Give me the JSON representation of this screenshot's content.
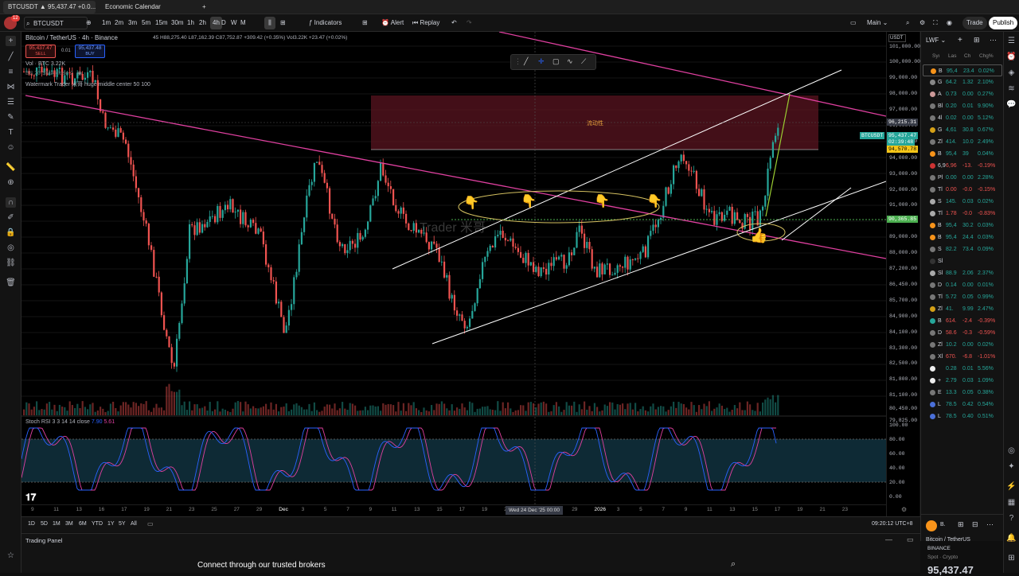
{
  "tabs": [
    {
      "label": "BTCUSDT ▲ 95,437.47 +0.0..."
    },
    {
      "label": "Economic Calendar"
    }
  ],
  "tab_add": "+",
  "toolbar": {
    "symbol": "BTCUSDT",
    "intervals": [
      "1m",
      "2m",
      "3m",
      "5m",
      "15m",
      "30m",
      "1h",
      "2h",
      "4h",
      "D",
      "W",
      "M"
    ],
    "active_interval": "4h",
    "indicators": "Indicators",
    "alert": "Alert",
    "replay": "Replay",
    "layout": "Main",
    "trade": "Trade",
    "publish": "Publish",
    "notif_count": "12"
  },
  "legend": {
    "title": "Bitcoin / TetherUS · 4h · Binance",
    "ohlc": "45  H88,275.40  L87,162.39  C87,752.87  +309.42 (+0.35%)  Vol3.22K  +23.47 (+0.02%)",
    "sell_price": "95,437.47",
    "sell_label": "SELL",
    "spread": "0.01",
    "buy_price": "95,437.48",
    "buy_label": "BUY",
    "vol": "Vol · BTC  3.22K",
    "bb": "BB 20 SMA close 2",
    "watermark_ind": "Watermark Trader 米哥 huge middle center 50 100",
    "watermark": "Trader 米哥",
    "zone_label": "流动性"
  },
  "stoch": {
    "title": "Stoch RSI 3 3 14 14 close",
    "k": "7.90",
    "d": "5.61"
  },
  "price_axis": {
    "currency": "USDT",
    "ticks": [
      "101,000.00",
      "100,000.00",
      "99,000.00",
      "98,000.00",
      "97,000.00",
      "96,000.00",
      "95,000.00",
      "94,000.00",
      "93,000.00",
      "92,000.00",
      "91,000.00",
      "90,000.00",
      "89,000.00",
      "88,000.00",
      "87,200.00",
      "86,450.00",
      "85,700.00",
      "84,900.00",
      "84,100.00",
      "83,300.00",
      "82,500.00",
      "81,800.00",
      "81,100.00",
      "80,450.00",
      "79,825.00"
    ],
    "crosshair": "96,215.31",
    "last_symbol": "BTCUSDT",
    "last_price": "95,437.47",
    "countdown": "02:39:48",
    "level1": "94,570.78",
    "level2": "90,365.85",
    "osc_ticks": [
      "100.00",
      "80.00",
      "60.00",
      "40.00",
      "20.00",
      "0.00"
    ]
  },
  "time_axis": [
    "9",
    "11",
    "13",
    "16",
    "17",
    "19",
    "21",
    "23",
    "25",
    "27",
    "29",
    "Dec",
    "3",
    "5",
    "7",
    "9",
    "11",
    "13",
    "15",
    "17",
    "19",
    "21",
    "",
    "27",
    "29",
    "2026",
    "3",
    "5",
    "7",
    "9",
    "11",
    "13",
    "15",
    "17",
    "19",
    "21",
    "23"
  ],
  "crosshair_time": "Wed 24 Dec '25   00:00",
  "ranges": [
    "1D",
    "5D",
    "1M",
    "3M",
    "6M",
    "YTD",
    "1Y",
    "5Y",
    "All"
  ],
  "clock": "09:20:12 UTC+8",
  "trading_panel": "Trading Panel",
  "brokers": "Connect through our trusted brokers",
  "watchlist": {
    "name": "LWF",
    "headers": [
      "Syı",
      "Las",
      "Ch",
      "Chg%"
    ],
    "rows": [
      {
        "sym": "B",
        "last": "95,4",
        "ch": "23.4",
        "pct": "0.02%",
        "color": "#26a69a",
        "dot": "#f7931a"
      },
      {
        "sym": "G",
        "last": "64.2",
        "ch": "1.32",
        "pct": "2.10%",
        "color": "#26a69a",
        "dot": "#888"
      },
      {
        "sym": "A",
        "last": "0.73",
        "ch": "0.00",
        "pct": "0.27%",
        "color": "#26a69a",
        "dot": "#c99"
      },
      {
        "sym": "Bl",
        "last": "0.20",
        "ch": "0.01",
        "pct": "9.90%",
        "color": "#26a69a",
        "dot": "#777"
      },
      {
        "sym": "4l",
        "last": "0.02",
        "ch": "0.00",
        "pct": "5.12%",
        "color": "#26a69a",
        "dot": "#777"
      },
      {
        "sym": "G",
        "last": "4,61",
        "ch": "30.8",
        "pct": "0.67%",
        "color": "#26a69a",
        "dot": "#d4a017"
      },
      {
        "sym": "Zl",
        "last": "414.",
        "ch": "10.0",
        "pct": "2.49%",
        "color": "#26a69a",
        "dot": "#777"
      },
      {
        "sym": "B",
        "last": "95,4",
        "ch": "39",
        "pct": "0.04%",
        "color": "#26a69a",
        "dot": "#f7931a"
      },
      {
        "sym": "6,9",
        "last": "6,96",
        "ch": "-13.",
        "pct": "-0.19%",
        "color": "#ef5350",
        "dot": "#c33"
      },
      {
        "sym": "Pl",
        "last": "0.00",
        "ch": "0.00",
        "pct": "2.28%",
        "color": "#26a69a",
        "dot": "#777"
      },
      {
        "sym": "Tl",
        "last": "0.00",
        "ch": "-0.0",
        "pct": "-0.15%",
        "color": "#ef5350",
        "dot": "#777"
      },
      {
        "sym": "S",
        "last": "145.",
        "ch": "0.03",
        "pct": "0.02%",
        "color": "#26a69a",
        "dot": "#aaa"
      },
      {
        "sym": "Tl",
        "last": "1.78",
        "ch": "-0.0",
        "pct": "-0.83%",
        "color": "#ef5350",
        "dot": "#aaa"
      },
      {
        "sym": "B",
        "last": "95,4",
        "ch": "30.2",
        "pct": "0.03%",
        "color": "#26a69a",
        "dot": "#f7931a"
      },
      {
        "sym": "B",
        "last": "95,4",
        "ch": "24.4",
        "pct": "0.03%",
        "color": "#26a69a",
        "dot": "#f7931a"
      },
      {
        "sym": "S",
        "last": "82.2",
        "ch": "73.4",
        "pct": "0.09%",
        "color": "#26a69a",
        "dot": "#777"
      },
      {
        "sym": "Sl",
        "last": "",
        "ch": "",
        "pct": "",
        "color": "#ef5350",
        "dot": "#333"
      },
      {
        "sym": "Sl",
        "last": "88.9",
        "ch": "2.06",
        "pct": "2.37%",
        "color": "#26a69a",
        "dot": "#aaa"
      },
      {
        "sym": "D",
        "last": "0.14",
        "ch": "0.00",
        "pct": "0.01%",
        "color": "#26a69a",
        "dot": "#777"
      },
      {
        "sym": "Tl",
        "last": "5.72",
        "ch": "0.05",
        "pct": "0.99%",
        "color": "#26a69a",
        "dot": "#777"
      },
      {
        "sym": "Zl",
        "last": "41.",
        "ch": "9.99",
        "pct": "2.47%",
        "color": "#26a69a",
        "dot": "#d4a017"
      },
      {
        "sym": "B",
        "last": "614.",
        "ch": "-2.4",
        "pct": "-0.39%",
        "color": "#ef5350",
        "dot": "#26a69a"
      },
      {
        "sym": "D",
        "last": "58.6",
        "ch": "-0.3",
        "pct": "-0.59%",
        "color": "#ef5350",
        "dot": "#777"
      },
      {
        "sym": "Zl",
        "last": "10.2",
        "ch": "0.00",
        "pct": "0.02%",
        "color": "#26a69a",
        "dot": "#777"
      },
      {
        "sym": "Xl",
        "last": "670.",
        "ch": "-6.8",
        "pct": "-1.01%",
        "color": "#ef5350",
        "dot": "#777"
      },
      {
        "sym": "",
        "last": "0.28",
        "ch": "0.01",
        "pct": "5.56%",
        "color": "#26a69a",
        "dot": "#eee"
      },
      {
        "sym": "+",
        "last": "2.79",
        "ch": "0.03",
        "pct": "1.09%",
        "color": "#26a69a",
        "dot": "#eee"
      },
      {
        "sym": "E",
        "last": "13.3",
        "ch": "0.05",
        "pct": "0.38%",
        "color": "#26a69a",
        "dot": "#777"
      },
      {
        "sym": "L",
        "last": "78.5",
        "ch": "0.42",
        "pct": "0.54%",
        "color": "#26a69a",
        "dot": "#4a6fd8"
      },
      {
        "sym": "L",
        "last": "78.5",
        "ch": "0.40",
        "pct": "0.51%",
        "color": "#26a69a",
        "dot": "#4a6fd8"
      }
    ],
    "detail_name": "Bitcoin / TetherUS",
    "detail_exchange": "BINANCE",
    "detail_type": "Spot · Crypto",
    "detail_price": "95,437.47"
  },
  "colors": {
    "up": "#26a69a",
    "down": "#ef5350",
    "trend": "#e040a0",
    "accent": "#2962ff",
    "zone": "#5a1420",
    "stoch_k": "#2962ff",
    "stoch_d": "#e040a0"
  }
}
